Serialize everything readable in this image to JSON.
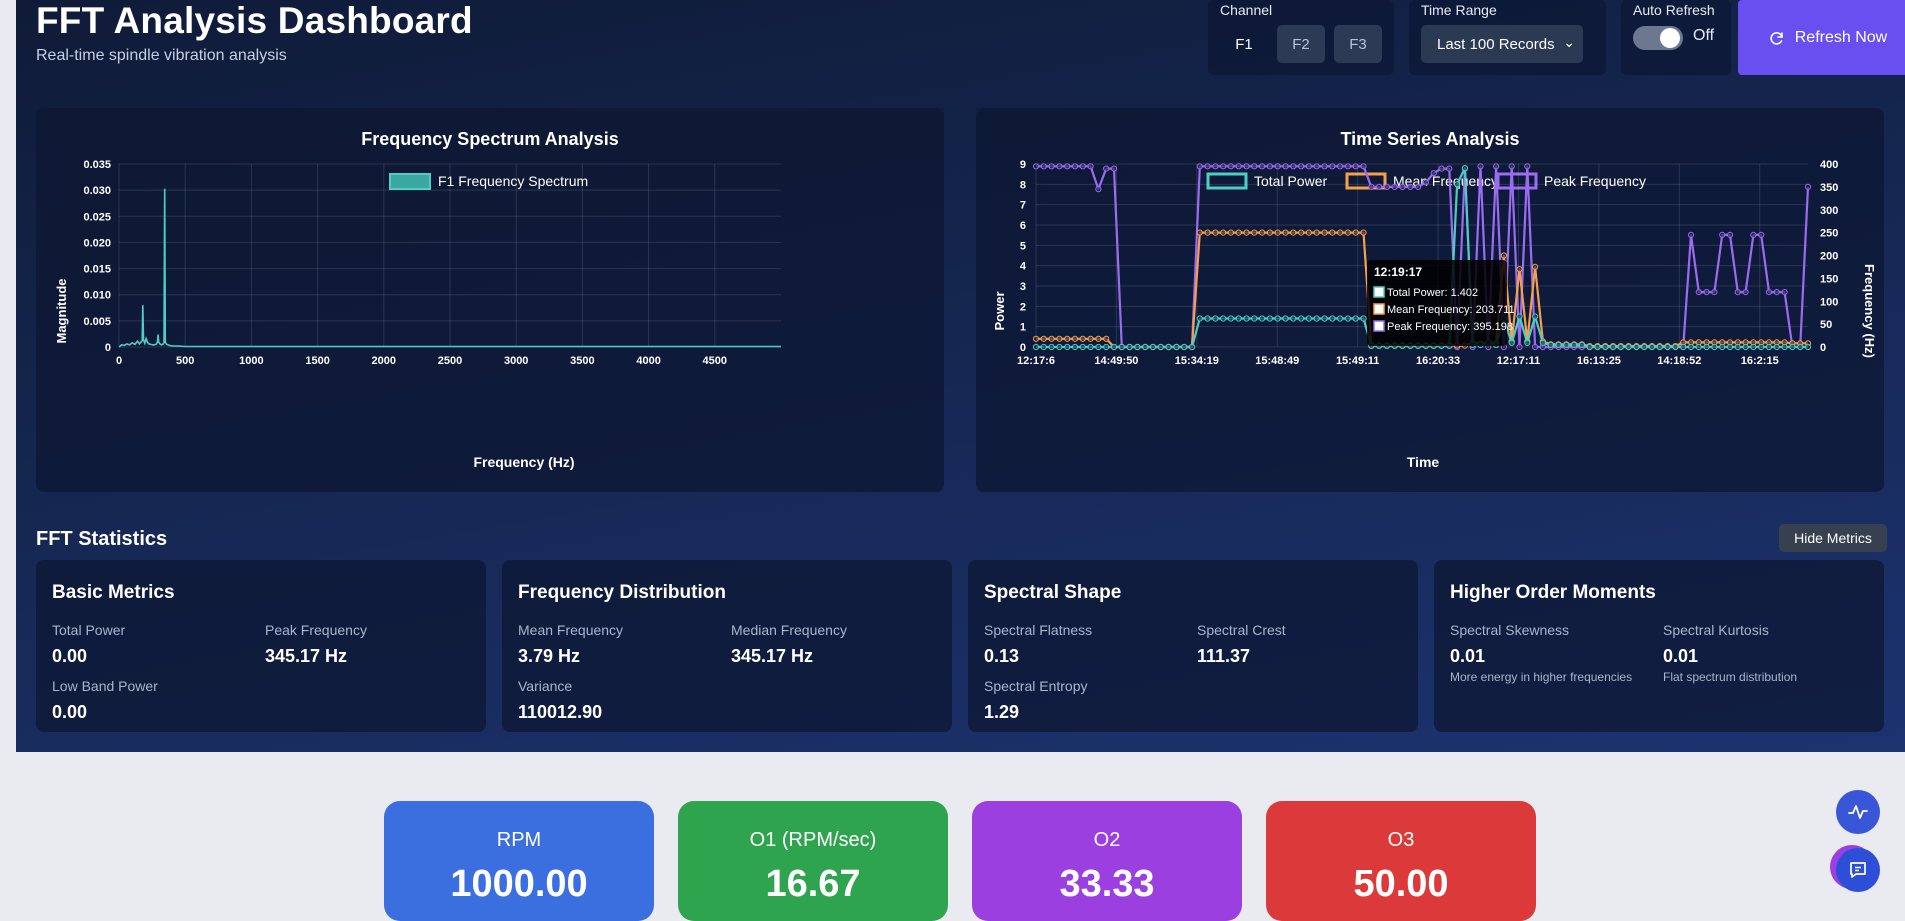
{
  "header": {
    "title": "FFT Analysis Dashboard",
    "subtitle": "Real-time spindle vibration analysis"
  },
  "controls": {
    "channel_label": "Channel",
    "channels": [
      "F1",
      "F2",
      "F3"
    ],
    "active_channel": "F1",
    "time_range_label": "Time Range",
    "time_range_value": "Last 100 Records",
    "auto_refresh_label": "Auto Refresh",
    "auto_refresh_state": "Off",
    "refresh_label": "Refresh Now"
  },
  "spectrum_chart": {
    "title": "Frequency Spectrum Analysis",
    "legend": "F1 Frequency Spectrum",
    "xlabel": "Frequency (Hz)",
    "ylabel": "Magnitude",
    "xticks": [
      "0",
      "500",
      "1000",
      "1500",
      "2000",
      "2500",
      "3000",
      "3500",
      "4000",
      "4500"
    ],
    "yticks": [
      "0",
      "0.005",
      "0.010",
      "0.015",
      "0.020",
      "0.025",
      "0.030",
      "0.035"
    ]
  },
  "timeseries_chart": {
    "title": "Time Series Analysis",
    "legend": [
      "Total Power",
      "Mean Frequency",
      "Peak Frequency"
    ],
    "xlabel": "Time",
    "ylabel_left": "Power",
    "ylabel_right": "Frequency (Hz)",
    "xticks": [
      "12:17:6",
      "14:49:50",
      "15:34:19",
      "15:48:49",
      "15:49:11",
      "16:20:33",
      "12:17:11",
      "16:13:25",
      "14:18:52",
      "16:2:15"
    ],
    "yticks_left": [
      "0",
      "1",
      "2",
      "3",
      "4",
      "5",
      "6",
      "7",
      "8",
      "9"
    ],
    "yticks_right": [
      "0",
      "50",
      "100",
      "150",
      "200",
      "250",
      "300",
      "350",
      "400"
    ],
    "tooltip": {
      "title": "12:19:17",
      "total_power": "Total Power: 1.402",
      "mean_frequency": "Mean Frequency: 203.711",
      "peak_frequency": "Peak Frequency: 395.198"
    }
  },
  "chart_data": [
    {
      "type": "line",
      "title": "Frequency Spectrum Analysis",
      "xlabel": "Frequency (Hz)",
      "ylabel": "Magnitude",
      "xlim": [
        0,
        5000
      ],
      "ylim": [
        0,
        0.035
      ],
      "grid": true,
      "legend_position": "top",
      "series": [
        {
          "name": "F1 Frequency Spectrum",
          "color": "#4ecdc4",
          "x": [
            0,
            10,
            20,
            40,
            60,
            80,
            100,
            120,
            140,
            155,
            165,
            175,
            180,
            185,
            195,
            205,
            215,
            225,
            240,
            260,
            280,
            290,
            295,
            300,
            310,
            320,
            330,
            340,
            345,
            350,
            360,
            380,
            400,
            450,
            500,
            600,
            800,
            1000,
            1500,
            2000,
            2500,
            3000,
            3500,
            4000,
            4500,
            5000
          ],
          "y": [
            0,
            0.0002,
            0.0004,
            0.0003,
            0.0006,
            0.0004,
            0.0008,
            0.0005,
            0.0011,
            0.0006,
            0.0009,
            0.0012,
            0.008,
            0.0014,
            0.0007,
            0.0016,
            0.0009,
            0.0006,
            0.0005,
            0.0004,
            0.0005,
            0.0009,
            0.0024,
            0.0009,
            0.0006,
            0.0004,
            0.0005,
            0.0008,
            0.0303,
            0.0009,
            0.0005,
            0.0003,
            0.0002,
            0.0002,
            0.0001,
            0.0001,
            0.0001,
            0.0001,
            0.0001,
            0.0001,
            0.0001,
            0.0001,
            0.0001,
            0.0001,
            0.0001,
            0.0001
          ]
        }
      ]
    },
    {
      "type": "line",
      "title": "Time Series Analysis",
      "xlabel": "Time",
      "ylabel": "Power",
      "ylabel_right": "Frequency (Hz)",
      "ylim": [
        0,
        9
      ],
      "ylim_right": [
        0,
        400
      ],
      "grid": true,
      "legend_position": "top",
      "categories": [
        "12:17:6",
        "14:49:50",
        "15:34:19",
        "15:48:49",
        "15:49:11",
        "16:20:33",
        "12:17:11",
        "16:13:25",
        "14:18:52",
        "16:2:15"
      ],
      "series": [
        {
          "name": "Total Power",
          "axis": "left",
          "color": "#4ecdc4",
          "values": [
            0,
            0,
            0,
            0,
            0,
            0,
            0,
            0,
            0,
            0,
            0,
            0,
            0,
            0,
            0,
            0,
            0,
            0,
            0,
            0,
            0,
            1.4,
            1.4,
            1.4,
            1.4,
            1.4,
            1.4,
            1.4,
            1.4,
            1.4,
            1.4,
            1.4,
            1.4,
            1.4,
            1.4,
            1.4,
            1.4,
            1.4,
            1.4,
            1.4,
            1.4,
            1.4,
            1.4,
            0.05,
            0.05,
            0.05,
            0.05,
            0.05,
            0.05,
            0.05,
            0.05,
            0.05,
            0.05,
            0.05,
            8.0,
            8.8,
            0.1,
            0.1,
            0.2,
            0.1,
            1.4,
            0.2,
            1.5,
            0.2,
            1.5,
            0.2,
            0.1,
            0.1,
            0.1,
            0.1,
            0.1,
            0,
            0,
            0,
            0,
            0,
            0,
            0,
            0,
            0,
            0,
            0,
            0,
            0,
            0,
            0,
            0,
            0,
            0,
            0,
            0,
            0,
            0,
            0,
            0,
            0,
            0,
            0,
            0,
            0
          ]
        },
        {
          "name": "Mean Frequency",
          "axis": "right",
          "color": "#f6a04d",
          "values": [
            18,
            18,
            18,
            18,
            18,
            18,
            18,
            18,
            18,
            18,
            0,
            0,
            0,
            0,
            0,
            0,
            0,
            0,
            0,
            0,
            0,
            250,
            250,
            250,
            250,
            250,
            250,
            250,
            250,
            250,
            250,
            250,
            250,
            250,
            250,
            250,
            250,
            250,
            250,
            250,
            250,
            250,
            250,
            4,
            4,
            4,
            4,
            4,
            4,
            4,
            4,
            4,
            4,
            4,
            3,
            3,
            10,
            8,
            10,
            8,
            200,
            12,
            170,
            12,
            175,
            12,
            6,
            6,
            6,
            6,
            6,
            2,
            2,
            2,
            2,
            2,
            2,
            2,
            2,
            2,
            2,
            2,
            2,
            10,
            10,
            10,
            10,
            10,
            10,
            10,
            10,
            10,
            10,
            10,
            10,
            10,
            10,
            8,
            8,
            8
          ]
        },
        {
          "name": "Peak Frequency",
          "axis": "right",
          "color": "#9b6bf2",
          "values": [
            395,
            395,
            395,
            395,
            395,
            395,
            395,
            395,
            345,
            390,
            390,
            0,
            0,
            0,
            0,
            0,
            0,
            0,
            0,
            0,
            0,
            395,
            395,
            395,
            395,
            395,
            395,
            395,
            395,
            395,
            395,
            395,
            395,
            395,
            395,
            395,
            395,
            395,
            395,
            395,
            395,
            395,
            395,
            350,
            350,
            350,
            350,
            350,
            350,
            350,
            360,
            380,
            390,
            390,
            0,
            390,
            0,
            395,
            0,
            395,
            0,
            395,
            0,
            395,
            0,
            0,
            0,
            0,
            0,
            0,
            0,
            0,
            0,
            0,
            0,
            0,
            0,
            0,
            0,
            0,
            0,
            0,
            0,
            0,
            245,
            120,
            120,
            120,
            245,
            245,
            120,
            120,
            245,
            245,
            120,
            120,
            120,
            0,
            0,
            350
          ]
        }
      ]
    }
  ],
  "statistics": {
    "title": "FFT Statistics",
    "hide_label": "Hide Metrics",
    "basic": {
      "title": "Basic Metrics",
      "total_power_label": "Total Power",
      "total_power": "0.00",
      "peak_freq_label": "Peak Frequency",
      "peak_freq": "345.17 Hz",
      "low_band_label": "Low Band Power",
      "low_band": "0.00"
    },
    "distribution": {
      "title": "Frequency Distribution",
      "mean_label": "Mean Frequency",
      "mean": "3.79 Hz",
      "median_label": "Median Frequency",
      "median": "345.17 Hz",
      "variance_label": "Variance",
      "variance": "110012.90"
    },
    "shape": {
      "title": "Spectral Shape",
      "flatness_label": "Spectral Flatness",
      "flatness": "0.13",
      "crest_label": "Spectral Crest",
      "crest": "111.37",
      "entropy_label": "Spectral Entropy",
      "entropy": "1.29"
    },
    "moments": {
      "title": "Higher Order Moments",
      "skewness_label": "Spectral Skewness",
      "skewness": "0.01",
      "skewness_note": "More energy in higher frequencies",
      "kurtosis_label": "Spectral Kurtosis",
      "kurtosis": "0.01",
      "kurtosis_note": "Flat spectrum distribution"
    }
  },
  "tiles": [
    {
      "label": "RPM",
      "value": "1000.00",
      "color": "#3b6fe0"
    },
    {
      "label": "O1 (RPM/sec)",
      "value": "16.67",
      "color": "#2ea44f"
    },
    {
      "label": "O2",
      "value": "33.33",
      "color": "#9b3fe0"
    },
    {
      "label": "O3",
      "value": "50.00",
      "color": "#dc3a3a"
    }
  ],
  "icons": {
    "refresh": "refresh-icon",
    "pulse": "pulse-icon",
    "chat": "chat-icon"
  }
}
